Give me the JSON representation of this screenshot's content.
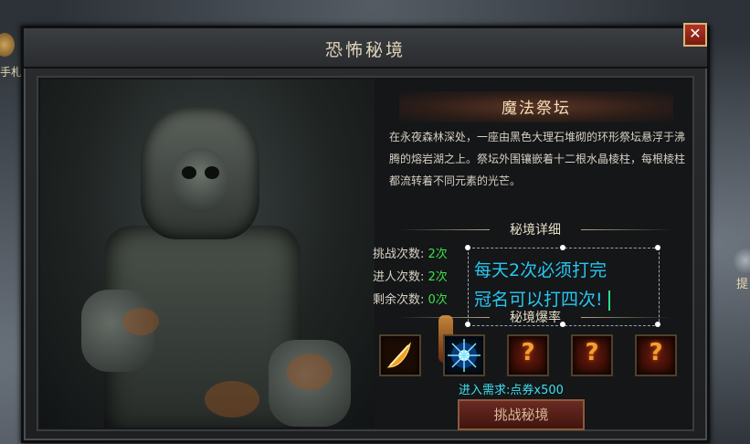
{
  "window": {
    "title": "恐怖秘境",
    "close_symbol": "✕"
  },
  "edge": {
    "left_text": "手札",
    "right_text": "提"
  },
  "dungeon": {
    "name": "魔法祭坛",
    "description": "在永夜森林深处，一座由黑色大理石堆砌的环形祭坛悬浮于沸腾的熔岩湖之上。祭坛外围镶嵌着十二根水晶棱柱，每根棱柱都流转着不同元素的光芒。"
  },
  "details": {
    "header": "秘境详细",
    "stats": [
      {
        "label": "挑战次数:",
        "value": "2次"
      },
      {
        "label": "进人次数:",
        "value": "2次"
      },
      {
        "label": "剩余次数:",
        "value": "0次"
      }
    ]
  },
  "editor_overlay": {
    "line1": "每天2次必须打完",
    "line2": "冠名可以打四次!"
  },
  "drops": {
    "header": "秘境爆率",
    "items": [
      {
        "icon": "feather-weapon-icon"
      },
      {
        "icon": "blue-star-burst-icon"
      },
      {
        "icon": "question-mark-icon",
        "symbol": "?"
      },
      {
        "icon": "question-mark-icon",
        "symbol": "?"
      },
      {
        "icon": "question-mark-icon",
        "symbol": "?"
      }
    ]
  },
  "requirement": "进入需求:点券x500",
  "challenge_button": "挑战秘境",
  "colors": {
    "stat_value": "#3ee04a",
    "overlay_text": "#27c7f0",
    "requirement_text": "#3fe0f0",
    "close_button": "#b03424"
  }
}
